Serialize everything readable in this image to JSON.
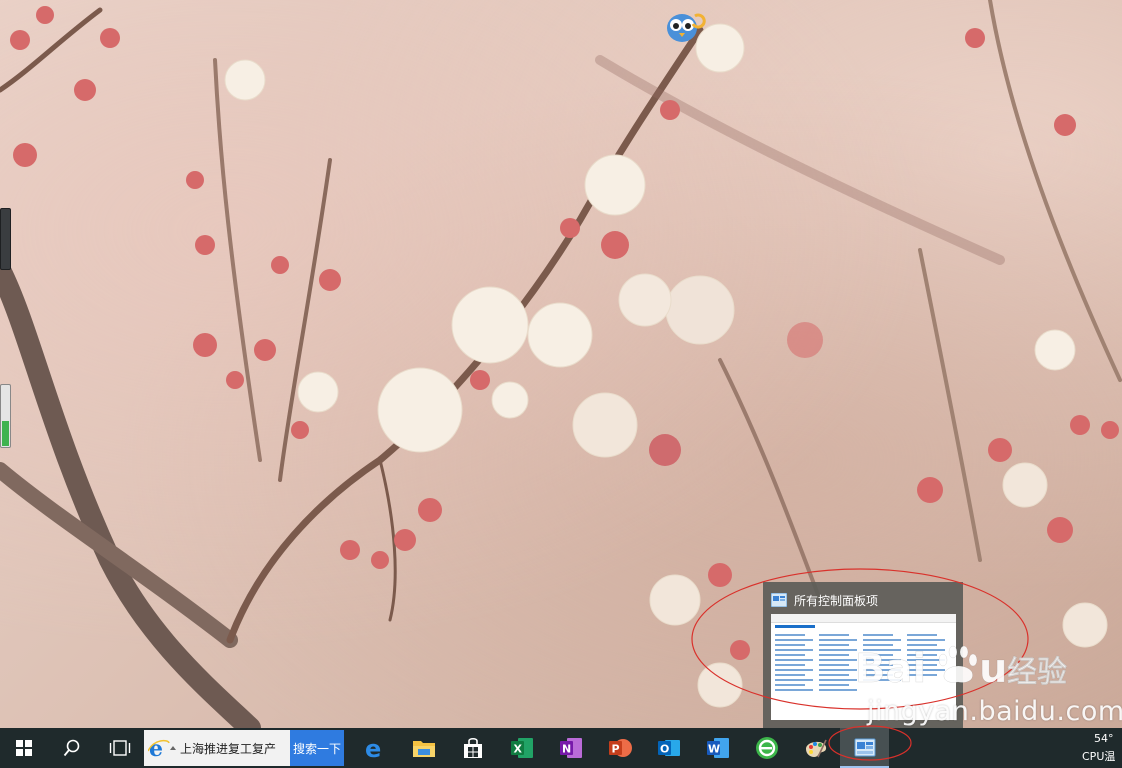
{
  "desktop": {
    "mascot_icon": "cartoon-bird-icon"
  },
  "side_gadgets": {
    "level": 0.4
  },
  "taskbar_preview": {
    "title": "所有控制面板项",
    "icon": "control-panel-icon"
  },
  "watermark": {
    "url": "jingyan.baidu.com"
  },
  "taskbar": {
    "start_icon": "windows-start-icon",
    "search_icon": "search-icon",
    "task_view_icon": "task-view-icon",
    "search_box": {
      "icon": "ie-icon",
      "text": "上海推进复工复产",
      "button": "搜索一下"
    },
    "apps": [
      {
        "name": "edge",
        "icon": "edge-icon"
      },
      {
        "name": "file-explorer",
        "icon": "folder-icon"
      },
      {
        "name": "store",
        "icon": "store-icon"
      },
      {
        "name": "excel",
        "icon": "excel-icon"
      },
      {
        "name": "onenote",
        "icon": "onenote-icon"
      },
      {
        "name": "powerpoint",
        "icon": "powerpoint-icon"
      },
      {
        "name": "outlook",
        "icon": "outlook-icon"
      },
      {
        "name": "word",
        "icon": "word-icon"
      },
      {
        "name": "360-browser",
        "icon": "browser-360-icon"
      },
      {
        "name": "paint",
        "icon": "paint-icon"
      },
      {
        "name": "control-panel",
        "icon": "control-panel-icon",
        "active": true
      }
    ],
    "tray": {
      "temperature": "54°",
      "cpu_label": "CPU温"
    }
  },
  "colors": {
    "taskbar_bg": "#1f2a2c",
    "search_button": "#2f7be0",
    "annotation_red": "#d9312b"
  }
}
